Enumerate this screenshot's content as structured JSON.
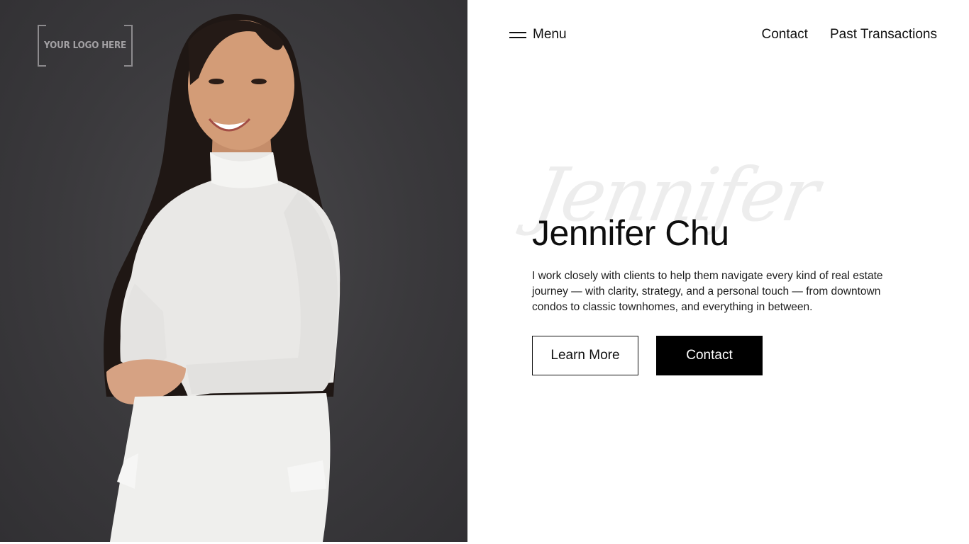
{
  "logo": {
    "text": "YOUR LOGO HERE"
  },
  "nav": {
    "menu_label": "Menu",
    "links": [
      "Contact",
      "Past Transactions"
    ]
  },
  "hero": {
    "script_name": "Jennifer",
    "name": "Jennifer Chu",
    "bio": "I work closely with clients to help them navigate every kind of real estate journey — with clarity, strategy, and a personal touch — from downtown condos to classic townhomes, and everything in between.",
    "primary_button": "Learn More",
    "secondary_button": "Contact"
  },
  "colors": {
    "photo_background": "#3a393c",
    "accent_button": "#000000",
    "text": "#111111"
  },
  "icons": [
    "hamburger-icon"
  ]
}
